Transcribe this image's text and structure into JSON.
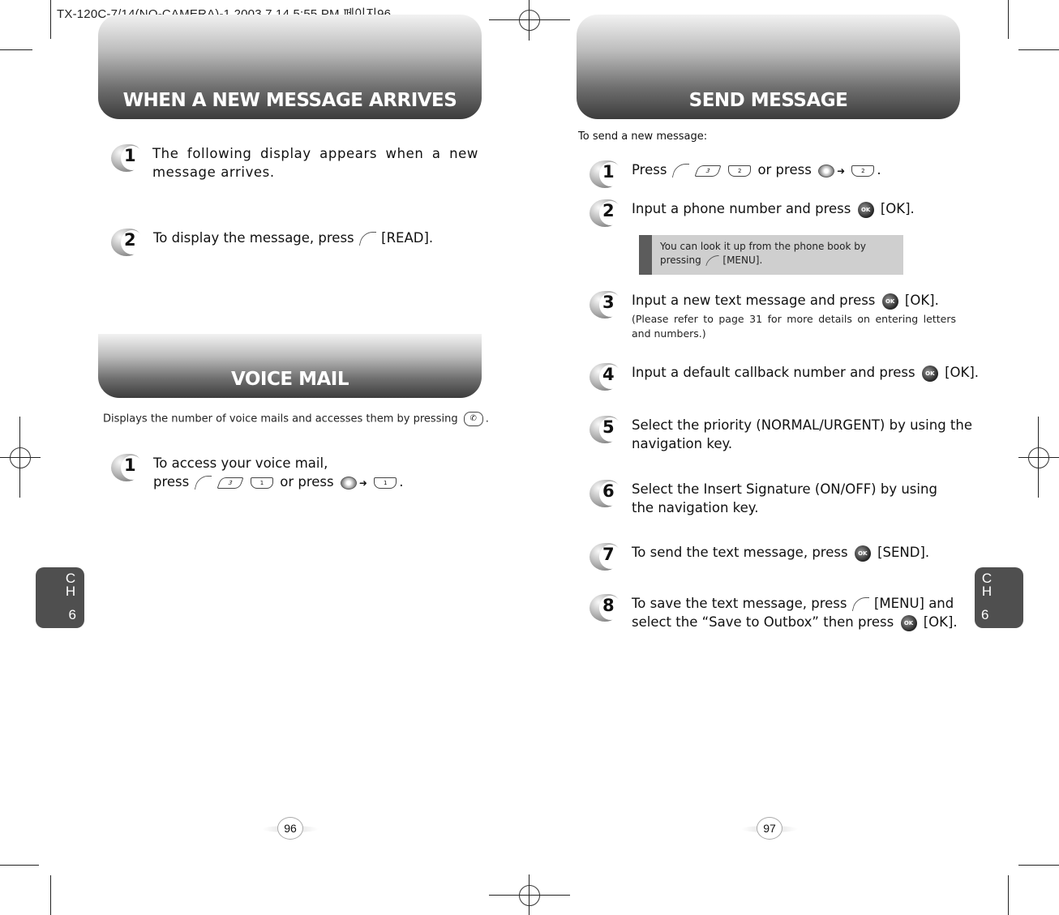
{
  "slug": "TX-120C-7/14(NO-CAMERA)-1  2003.7.14 5:55 PM 페이지96",
  "left_page": {
    "new_message": {
      "title": "WHEN A NEW MESSAGE ARRIVES",
      "steps": [
        {
          "num": "1",
          "text": "The following display appears when a new message arrives."
        },
        {
          "num": "2",
          "text_before": "To display the message, press",
          "text_after": "[READ].",
          "key": "left-soft-key"
        }
      ]
    },
    "voice_mail": {
      "title": "VOICE MAIL",
      "intro_before": "Displays the number of voice mails and accesses them by pressing",
      "intro_after": ".",
      "steps": [
        {
          "num": "1",
          "line1": "To access your voice mail,",
          "press": "press",
          "or_press": "or press",
          "end": ".",
          "keys": {
            "k2": "3",
            "k3": "1"
          }
        }
      ]
    },
    "chapter_tab": {
      "ch": "CH",
      "num": "6"
    },
    "page_number": "96"
  },
  "right_page": {
    "send_message": {
      "title": "SEND MESSAGE",
      "intro": "To send a new message:",
      "steps": [
        {
          "num": "1",
          "press": "Press",
          "or_press": "or press",
          "end": ".",
          "keys": {
            "k2": "3",
            "k3": "2"
          }
        },
        {
          "num": "2",
          "text_before": "Input a phone number and press",
          "text_after": "[OK]."
        },
        {
          "num": "3",
          "text_before": "Input a new text message and press",
          "text_after": "[OK].",
          "note": "(Please refer to page 31 for more details on entering letters and numbers.)"
        },
        {
          "num": "4",
          "text_before": "Input a default callback number and press",
          "text_after": "[OK]."
        },
        {
          "num": "5",
          "text": "Select the priority (NORMAL/URGENT) by using the navigation key."
        },
        {
          "num": "6",
          "text": "Select the Insert Signature (ON/OFF) by using the navigation key."
        },
        {
          "num": "7",
          "text_before": "To send the text message, press",
          "text_after": "[SEND]."
        },
        {
          "num": "8",
          "text_before": "To save the text message, press",
          "text_mid": "[MENU] and select the “Save to Outbox” then press",
          "text_after": "[OK]."
        }
      ],
      "tip": {
        "line1": "You can look it up from the phone book by",
        "pressing": "pressing",
        "menu": "[MENU]."
      }
    },
    "chapter_tab": {
      "ch": "CH",
      "num": "6"
    },
    "page_number": "97"
  },
  "icons": {
    "ok_label": "OK",
    "call_glyph": "✆",
    "arrow": "➜"
  }
}
